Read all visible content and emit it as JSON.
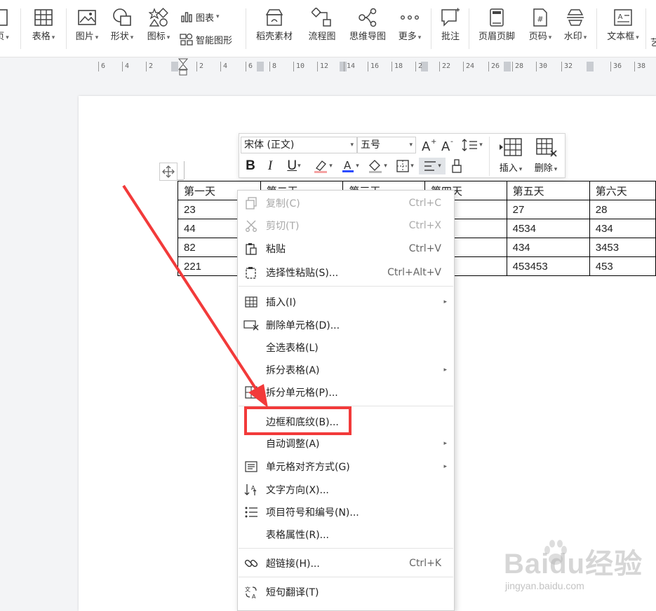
{
  "ribbon": {
    "left_cut_label": "页",
    "items": [
      {
        "label": "表格",
        "icon": "table-icon"
      },
      {
        "label": "图片",
        "icon": "picture-icon"
      },
      {
        "label": "形状",
        "icon": "shape-icon"
      },
      {
        "label": "图标",
        "icon": "icons-icon"
      },
      {
        "label": "稻壳素材",
        "icon": "docer-material-icon"
      },
      {
        "label": "流程图",
        "icon": "flowchart-icon"
      },
      {
        "label": "思维导图",
        "icon": "mindmap-icon"
      },
      {
        "label": "更多",
        "icon": "more-icon"
      },
      {
        "label": "批注",
        "icon": "comment-icon"
      },
      {
        "label": "页眉页脚",
        "icon": "header-footer-icon"
      },
      {
        "label": "页码",
        "icon": "page-number-icon"
      },
      {
        "label": "水印",
        "icon": "watermark-icon"
      },
      {
        "label": "文本框",
        "icon": "textbox-icon"
      }
    ],
    "chart_label": "图表",
    "smart_graphic_label": "智能图形",
    "right_cut_label": "艺"
  },
  "ruler": {
    "ticks": [
      "6",
      "4",
      "2",
      "2",
      "4",
      "6",
      "8",
      "10",
      "12",
      "14",
      "16",
      "18",
      "2",
      "22",
      "24",
      "26",
      "28",
      "30",
      "32",
      "34",
      "36",
      "38"
    ]
  },
  "mini_toolbar": {
    "font_name": "宋体 (正文)",
    "font_size": "五号",
    "bold": "B",
    "italic": "I",
    "underline": "U",
    "insert_label": "插入",
    "delete_label": "删除"
  },
  "table": {
    "header": [
      "第一天",
      "第二天",
      "第三天",
      "第四天",
      "第五天",
      "第六天"
    ],
    "rows": [
      [
        "23",
        "",
        "",
        "",
        "27",
        "28"
      ],
      [
        "44",
        "",
        "",
        "",
        "4534",
        "434"
      ],
      [
        "82",
        "",
        "",
        "",
        "434",
        "3453"
      ],
      [
        "221",
        "",
        "",
        "",
        "453453",
        "453"
      ]
    ]
  },
  "menu": {
    "items": [
      {
        "label": "复制(C)",
        "shortcut": "Ctrl+C",
        "icon": "copy-icon",
        "disabled": true
      },
      {
        "label": "剪切(T)",
        "shortcut": "Ctrl+X",
        "icon": "cut-icon",
        "disabled": true
      },
      {
        "label": "粘贴",
        "shortcut": "Ctrl+V",
        "icon": "paste-icon"
      },
      {
        "label": "选择性粘贴(S)...",
        "shortcut": "Ctrl+Alt+V",
        "icon": "paste-special-icon"
      },
      {
        "label": "插入(I)",
        "icon": "insert-table-icon",
        "submenu": true
      },
      {
        "label": "删除单元格(D)...",
        "icon": "delete-cell-icon"
      },
      {
        "label": "全选表格(L)"
      },
      {
        "label": "拆分表格(A)",
        "submenu": true
      },
      {
        "label": "拆分单元格(P)...",
        "icon": "split-cell-icon"
      },
      {
        "label": "边框和底纹(B)..."
      },
      {
        "label": "自动调整(A)",
        "submenu": true
      },
      {
        "label": "单元格对齐方式(G)",
        "icon": "cell-align-icon",
        "submenu": true
      },
      {
        "label": "文字方向(X)...",
        "icon": "text-direction-icon"
      },
      {
        "label": "项目符号和编号(N)...",
        "icon": "bullets-icon"
      },
      {
        "label": "表格属性(R)..."
      },
      {
        "label": "超链接(H)...",
        "shortcut": "Ctrl+K",
        "icon": "link-icon"
      },
      {
        "label": "短句翻译(T)",
        "icon": "translate-icon"
      }
    ]
  },
  "watermark": {
    "brand": "Baidu经验",
    "url": "jingyan.baidu.com"
  },
  "colors": {
    "highlight": "#f23a3a",
    "arrow": "#f23a3a",
    "font_color_bar": "#2b4cff"
  }
}
